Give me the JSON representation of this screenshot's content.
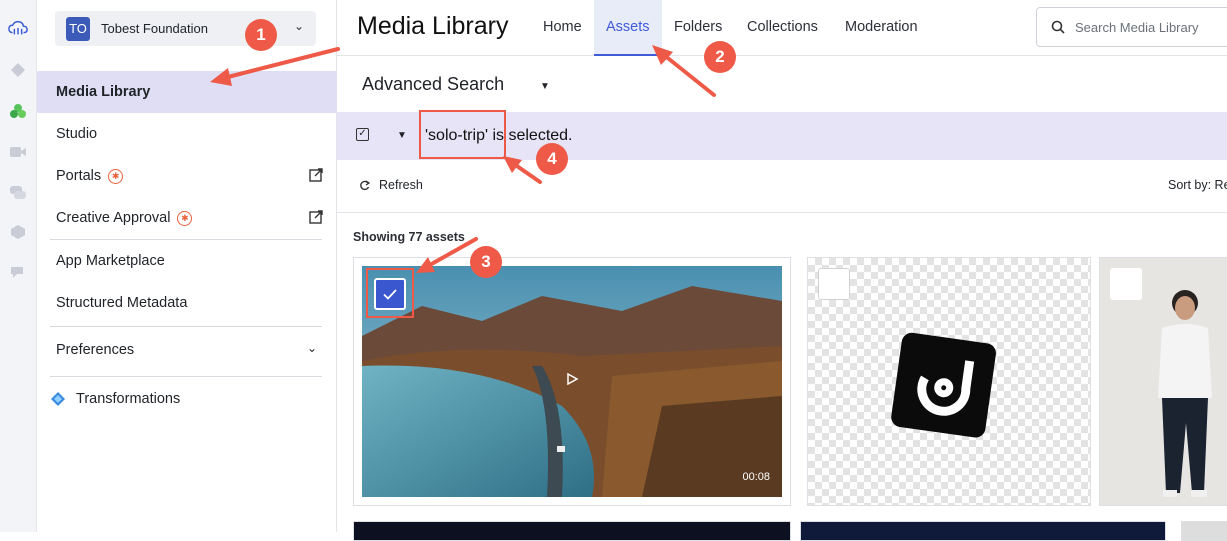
{
  "org": {
    "initials": "TO",
    "name": "Tobest Foundation"
  },
  "sidebar": {
    "items": [
      {
        "label": "Media Library"
      },
      {
        "label": "Studio"
      },
      {
        "label": "Portals"
      },
      {
        "label": "Creative Approval"
      },
      {
        "label": "App Marketplace"
      },
      {
        "label": "Structured Metadata"
      },
      {
        "label": "Preferences"
      },
      {
        "label": "Transformations"
      }
    ]
  },
  "header": {
    "title": "Media Library",
    "tabs": [
      {
        "label": "Home"
      },
      {
        "label": "Assets"
      },
      {
        "label": "Folders"
      },
      {
        "label": "Collections"
      },
      {
        "label": "Moderation"
      }
    ],
    "search_placeholder": "Search Media Library"
  },
  "advanced_search": {
    "label": "Advanced Search"
  },
  "selection": {
    "text": "'solo-trip' is selected."
  },
  "toolbar": {
    "refresh": "Refresh",
    "sort_by": "Sort by: Re"
  },
  "assets": {
    "count_text": "Showing 77 assets",
    "items": [
      {
        "duration": "00:08"
      }
    ]
  },
  "annotations": [
    "1",
    "2",
    "3",
    "4"
  ],
  "colors": {
    "accent": "#3f5bd8",
    "annotation": "#ee5a47",
    "selection_bg": "#e6e4f6"
  }
}
